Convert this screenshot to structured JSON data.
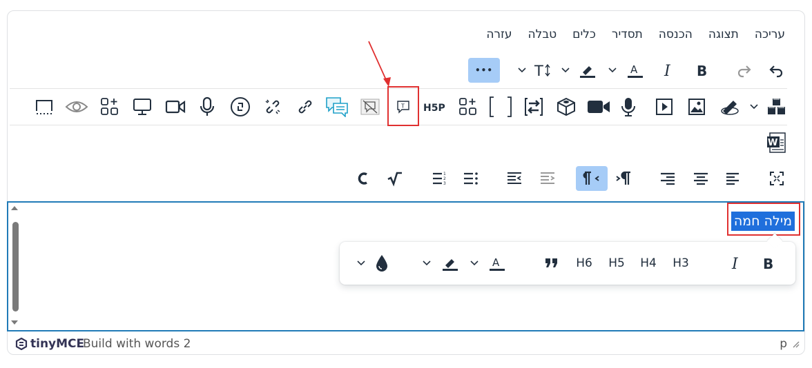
{
  "menubar": [
    "עריכה",
    "תצוגה",
    "הכנסה",
    "תסדיר",
    "כלים",
    "טבלה",
    "עזרה"
  ],
  "toolbar_more_label": "•••",
  "content": {
    "hot_word": "מילה חמה"
  },
  "quickbar": {
    "h3": "H3",
    "h4": "H4",
    "h5": "H5",
    "h6": "H6"
  },
  "statusbar": {
    "brand": "tinyMCE",
    "brand_sub": "Build with  words 2",
    "path": "p"
  },
  "colors": {
    "accent": "#207ab7",
    "active": "#a6ccf7",
    "highlight": "#e03030",
    "selection": "#1f6fdc"
  }
}
